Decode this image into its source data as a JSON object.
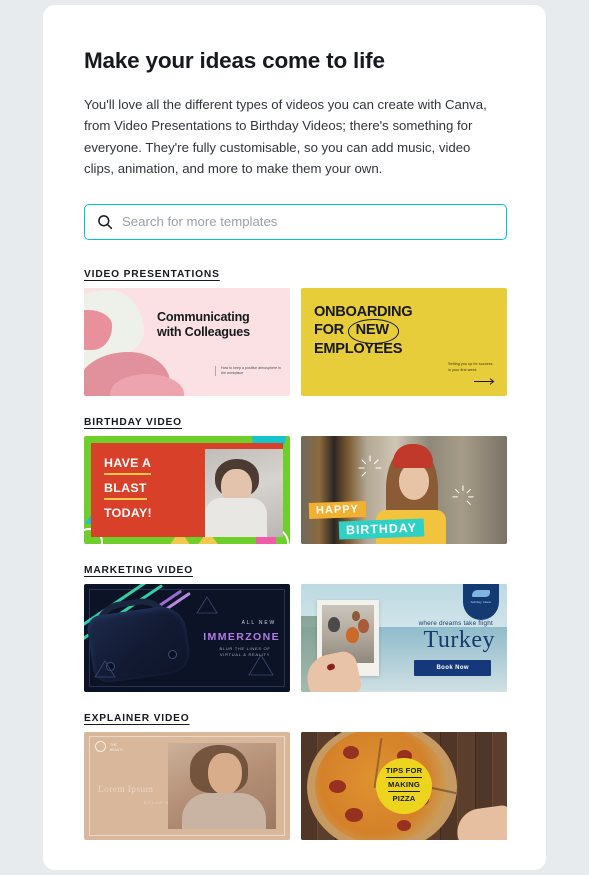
{
  "header": {
    "title": "Make your ideas come to life",
    "description": "You'll love all the different types of videos you can create with Canva, from Video Presentations to Birthday Videos; there's something for everyone. They're fully customisable, so you can add music, video clips, animation, and more to make them your own."
  },
  "search": {
    "placeholder": "Search for more templates",
    "value": "",
    "icon": "search-icon",
    "border_color": "#00c4cc"
  },
  "sections": [
    {
      "label": "VIDEO PRESENTATIONS",
      "templates": [
        {
          "name": "communicating-with-colleagues",
          "title_line1": "Communicating",
          "title_line2": "with Colleagues",
          "subtitle": "How to keep a positive atmosphere in the workplace",
          "background_color": "#fbe1e3"
        },
        {
          "name": "onboarding-for-new-employees",
          "title_line1": "ONBOARDING",
          "title_line2_a": "FOR",
          "title_line2_b": "NEW",
          "title_line3": "EMPLOYEES",
          "subtitle": "Setting you up for success in your first week",
          "background_color": "#e8cd3a"
        }
      ]
    },
    {
      "label": "BIRTHDAY VIDEO",
      "templates": [
        {
          "name": "have-a-blast-today",
          "line1": "HAVE A",
          "line2": "BLAST",
          "line3": "TODAY!",
          "background_color": "#6fcf2a",
          "panel_color": "#d8402a"
        },
        {
          "name": "happy-birthday",
          "word1": "HAPPY",
          "word2": "BIRTHDAY",
          "highlight1_color": "#f2b033",
          "highlight2_color": "#2fd1c5"
        }
      ]
    },
    {
      "label": "MARKETING VIDEO",
      "templates": [
        {
          "name": "immerzone-vr",
          "eyebrow": "ALL NEW",
          "brand": "IMMERZONE",
          "tagline_line1": "BLUR THE LINES OF",
          "tagline_line2": "VIRTUAL & REALITY",
          "background_color": "#0d1326",
          "brand_color": "#b07ce8"
        },
        {
          "name": "turkey-travel",
          "tagline": "where dreams take flight",
          "destination": "Turkey",
          "button_label": "Book Now",
          "badge_label": "holiday travel",
          "accent_color": "#173a6e"
        }
      ]
    },
    {
      "label": "EXPLAINER VIDEO",
      "templates": [
        {
          "name": "beauty-explainer",
          "brand_text_line1": "THE",
          "brand_text_line2": "BEAUTY",
          "ghost_title": "Lorem Ipsum",
          "ghost_subtitle": "DOLOR SIT",
          "background_color": "#d9b79b"
        },
        {
          "name": "tips-for-making-pizza",
          "line1": "TIPS FOR",
          "line2": "MAKING",
          "line3": "PIZZA",
          "badge_color": "#ecd41f"
        }
      ]
    }
  ]
}
